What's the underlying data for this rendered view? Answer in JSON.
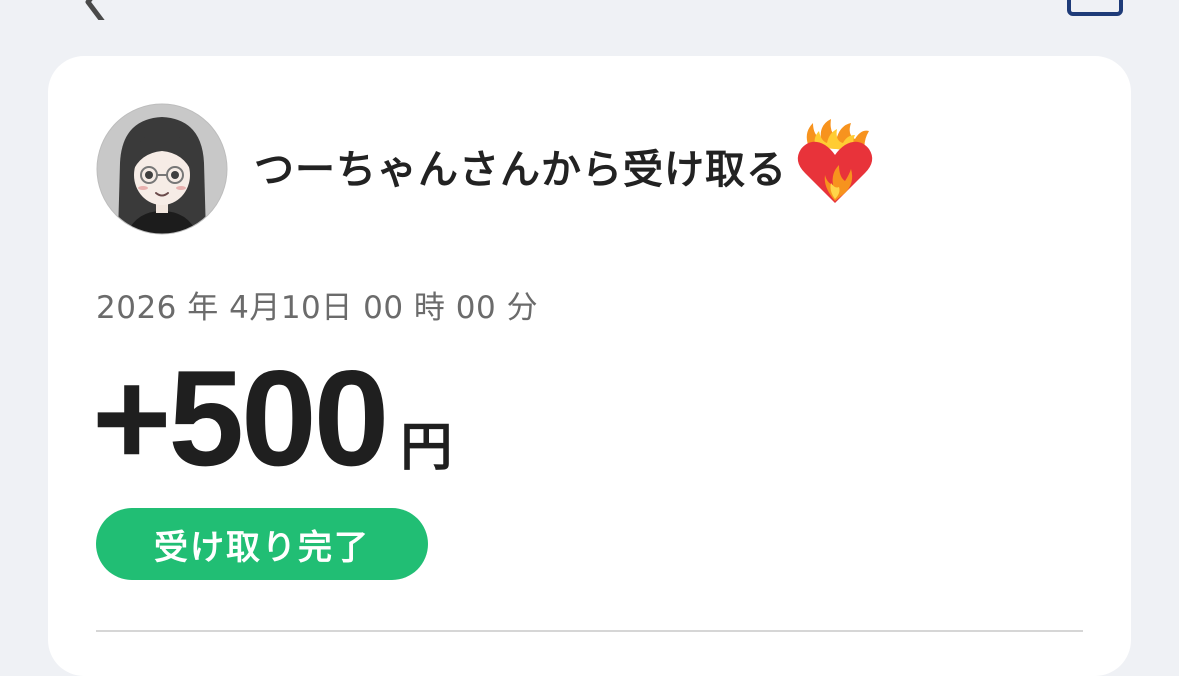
{
  "header": {
    "back_icon": "chevron-left-icon",
    "share_icon": "square-icon",
    "accent_color": "#1E3B78"
  },
  "transaction": {
    "sender_title": "つーちゃんさんから受け取る",
    "sender_emoji_icon": "heart-on-fire-icon",
    "date": "2026 年 4月10日 00 時 00 分",
    "amount": "+500",
    "currency": "円",
    "status": "受け取り完了",
    "status_color": "#21BE74"
  }
}
